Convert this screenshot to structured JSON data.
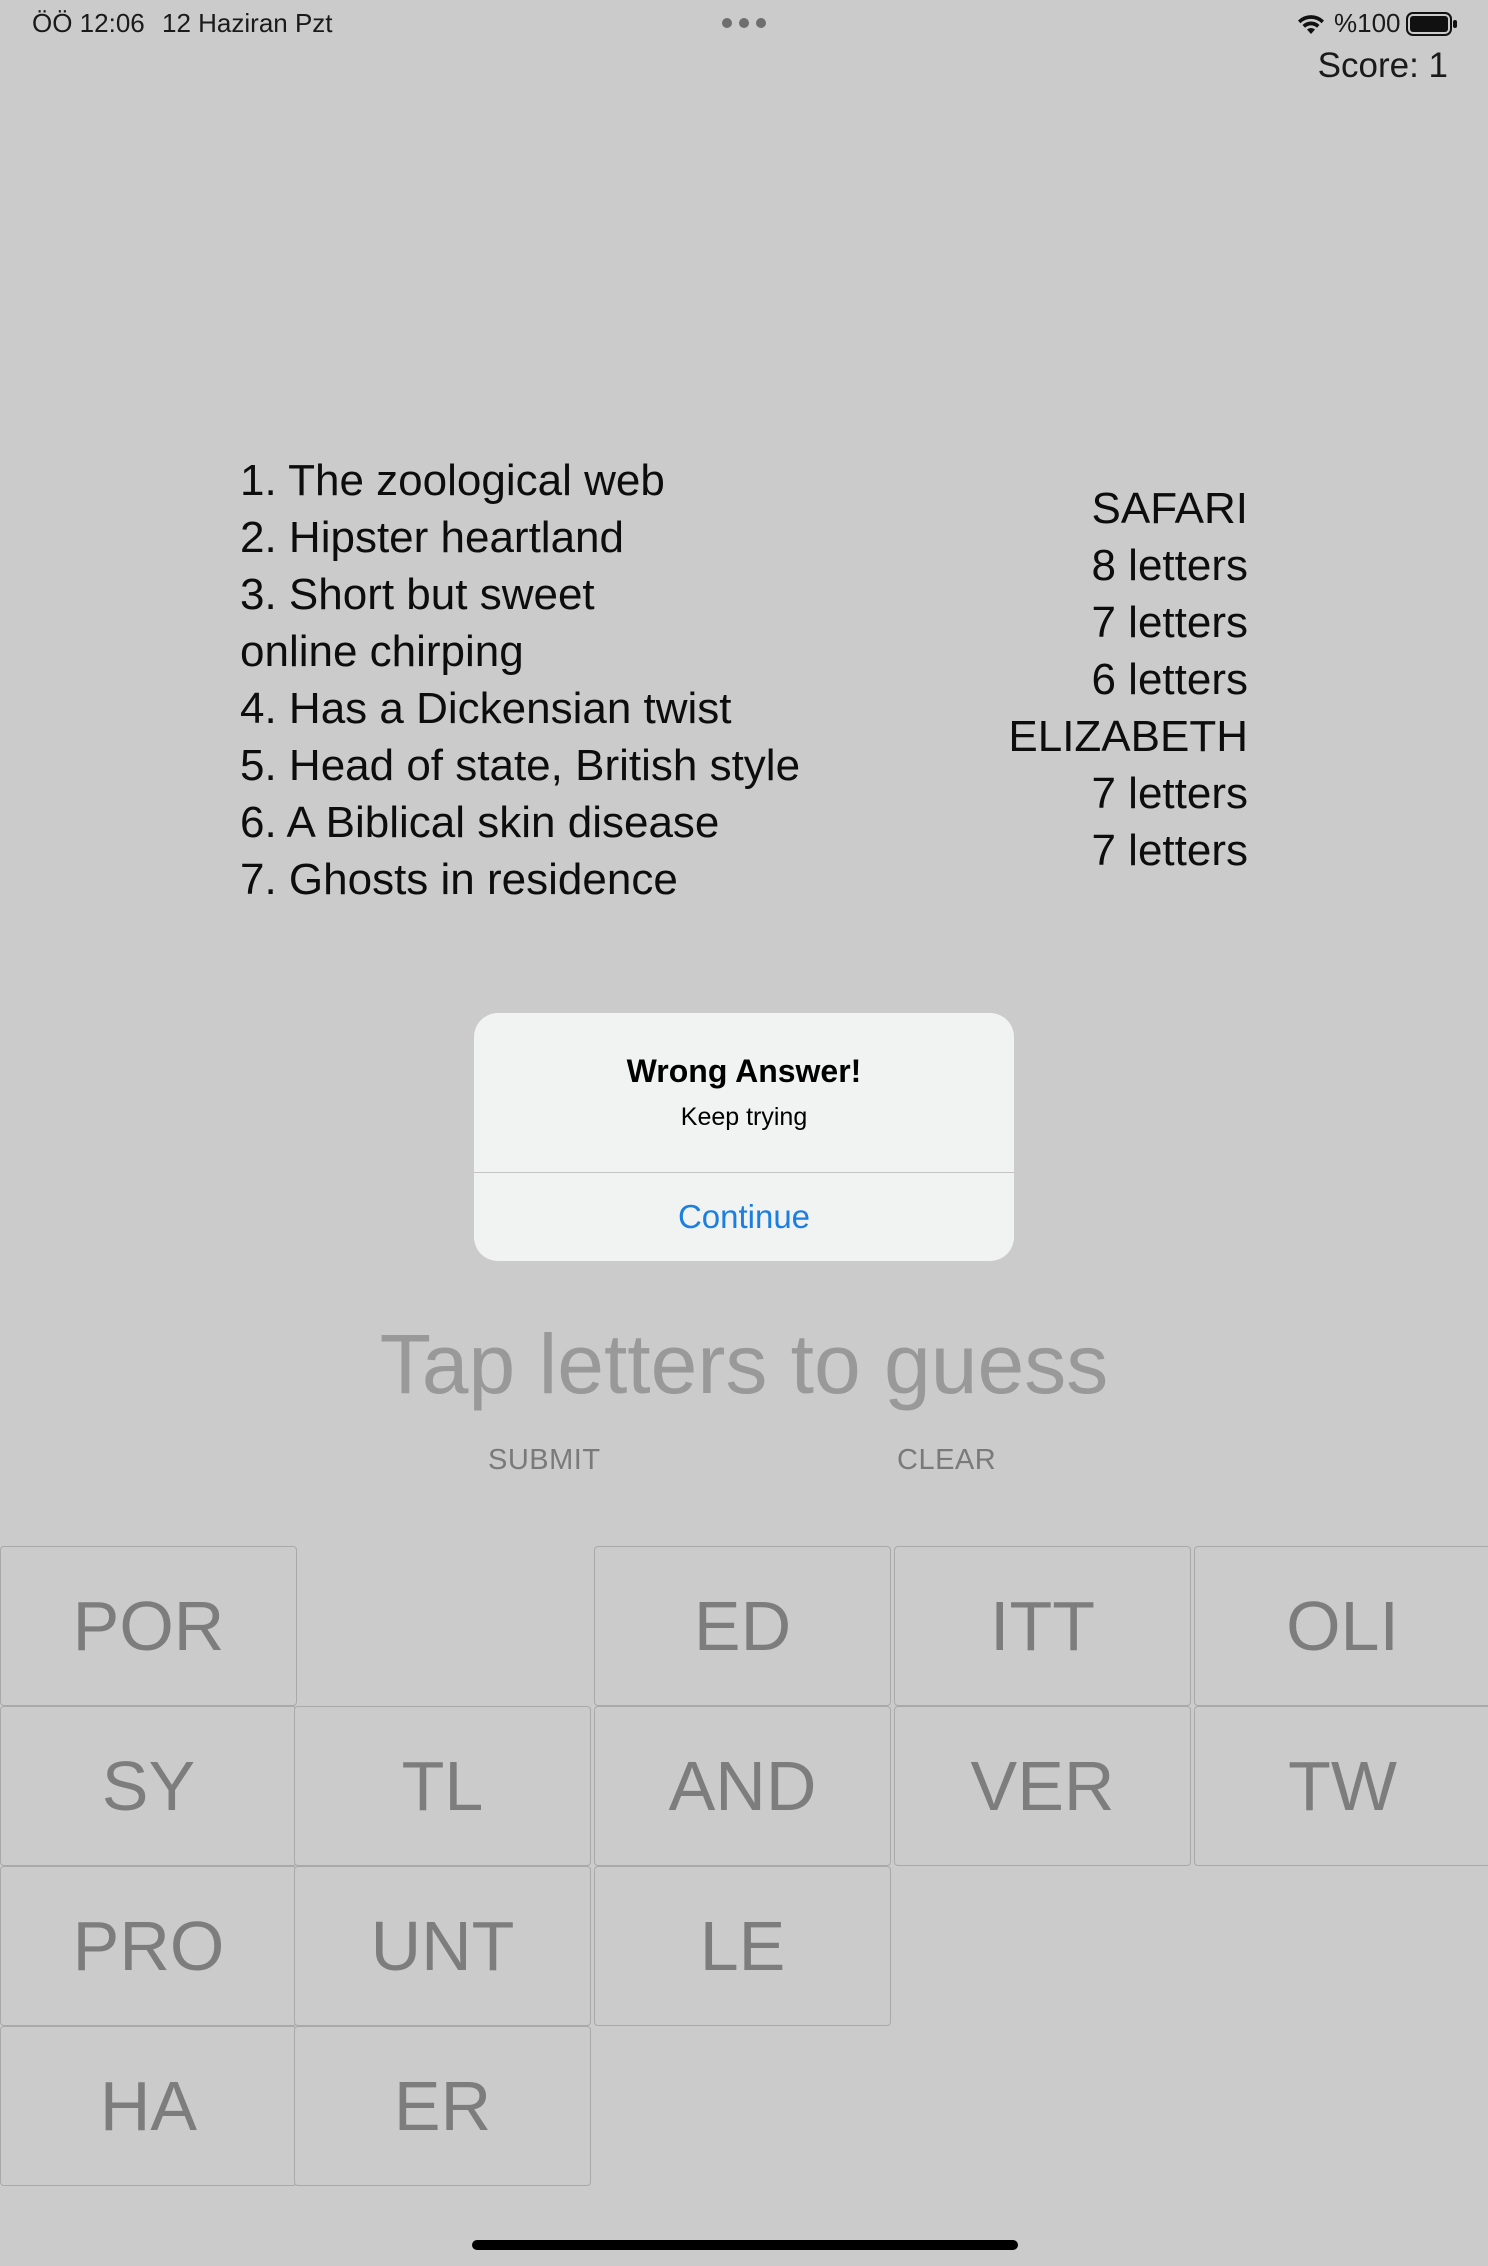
{
  "status_bar": {
    "time": "ÖÖ 12:06",
    "date": "12 Haziran Pzt",
    "battery": "%100",
    "icons": [
      "multitask-dots-icon",
      "wifi-icon",
      "battery-icon"
    ]
  },
  "game": {
    "score": "Score: 1",
    "clues": [
      "1. The zoological web",
      "2. Hipster heartland",
      "3. Short but sweet\nonline chirping",
      "4. Has a Dickensian twist",
      "5. Head of state, British style",
      "6. A Biblical skin disease",
      "7. Ghosts in residence"
    ],
    "answers": [
      "SAFARI",
      "8 letters",
      "7 letters",
      "6 letters",
      "ELIZABETH",
      "7 letters",
      "7 letters"
    ],
    "guess_placeholder": "Tap letters to guess",
    "submit_label": "SUBMIT",
    "clear_label": "CLEAR",
    "tiles": [
      [
        "POR",
        "",
        "ED",
        "ITT",
        "OLI"
      ],
      [
        "SY",
        "TL",
        "AND",
        "VER",
        "TW"
      ],
      [
        "PRO",
        "UNT",
        "LE",
        "",
        ""
      ],
      [
        "HA",
        "ER",
        "",
        "",
        ""
      ]
    ]
  },
  "alert": {
    "title": "Wrong Answer!",
    "message": "Keep trying",
    "button_label": "Continue"
  },
  "colors": {
    "background": "#cbcbcb",
    "alert_background": "#f1f2f2",
    "alert_button": "#1a7fe0",
    "tile_text": "#7d7d7d",
    "placeholder_text": "#999999"
  }
}
